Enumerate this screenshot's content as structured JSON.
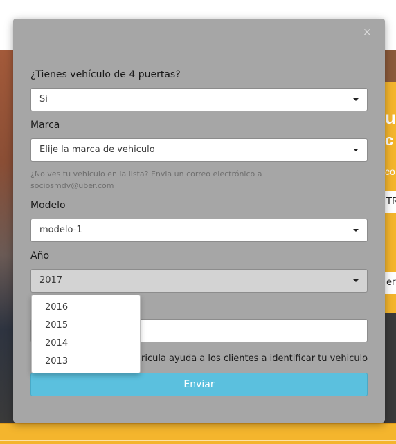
{
  "modal": {
    "close_label": "×",
    "q_doors_label": "¿Tienes vehículo de 4 puertas?",
    "q_doors_value": "Si",
    "brand_label": "Marca",
    "brand_placeholder": "Elije la marca de vehiculo",
    "help_text": "¿No ves tu vehiculo en la lista? Envia un correo electrónico a",
    "help_email": "sociosmdv@uber.com",
    "model_label": "Modelo",
    "model_value": "modelo-1",
    "year_label": "Año",
    "year_value": "2017",
    "plate_hint": "ricula ayuda a los clientes a identificar tu vehiculo",
    "submit_label": "Enviar"
  },
  "year_dropdown": {
    "options": [
      "2016",
      "2015",
      "2014",
      "2013"
    ]
  },
  "background": {
    "frag1": "u",
    "frag2": "c",
    "frag3": "co",
    "input1": "TR",
    "input2": "ert"
  },
  "colors": {
    "modal_bg": "#a6a6a6",
    "submit_bg": "#5bc0de",
    "accent_yellow": "#f4b52d"
  }
}
